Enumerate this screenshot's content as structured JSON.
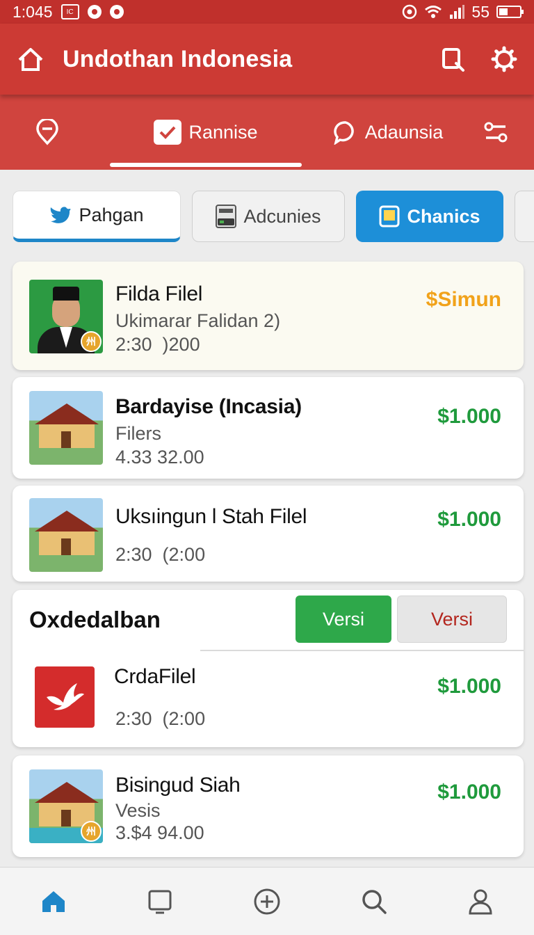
{
  "status_bar": {
    "time": "1:045",
    "box_icon_text": "IC",
    "signal_text": "55"
  },
  "app_bar": {
    "title": "Undothan Indonesia"
  },
  "top_nav": {
    "tabs": [
      {
        "label": "",
        "icon": "location-pin-icon"
      },
      {
        "label": "Rannise",
        "icon": "checkmark-icon",
        "active": true
      },
      {
        "label": "Adaunsia",
        "icon": "chat-bubble-icon"
      },
      {
        "label": "",
        "icon": "sliders-icon"
      }
    ]
  },
  "chips": [
    {
      "label": "Pahgan",
      "icon": "bird-icon"
    },
    {
      "label": "Adcunies",
      "icon": "card-reader-icon"
    },
    {
      "label": "Chanics",
      "icon": "tablet-icon",
      "selected": true
    }
  ],
  "listings": [
    {
      "name": "Filda Filel",
      "sub": "Ukimarar Falidan 2)",
      "meta": "2:30  )200",
      "price": "$Simun",
      "image": "person-photo",
      "badge": "州"
    },
    {
      "name": "Bardayise (Incasia)",
      "sub": "Filers",
      "meta": "4.33 32.00",
      "price": "$1.000",
      "image": "house-photo"
    },
    {
      "name": "Uksıingun l Stah Filel",
      "sub": "",
      "meta": "2:30  (2:00",
      "price": "$1.000",
      "image": "house-photo"
    }
  ],
  "section": {
    "title": "Oxdedalban",
    "buttons": [
      "Versi",
      "Versi"
    ],
    "item": {
      "name": "CrdaFilel",
      "meta": "2:30  (2:00",
      "price": "$1.000",
      "icon": "pdf-bird-icon"
    }
  },
  "last_listing": {
    "name": "Bisingud Siah",
    "sub": "Vesis",
    "meta": "3.$4 94.00",
    "price": "$1.000",
    "image": "house-pool-photo",
    "badge": "州"
  },
  "bottom_nav": [
    "home-icon",
    "tablet-icon",
    "add-circle-icon",
    "search-icon",
    "profile-icon"
  ],
  "colors": {
    "primary_red": "#cc3a34",
    "accent_blue": "#1d8fd8",
    "price_green": "#1f9a3c",
    "price_gold": "#f1a21a"
  }
}
